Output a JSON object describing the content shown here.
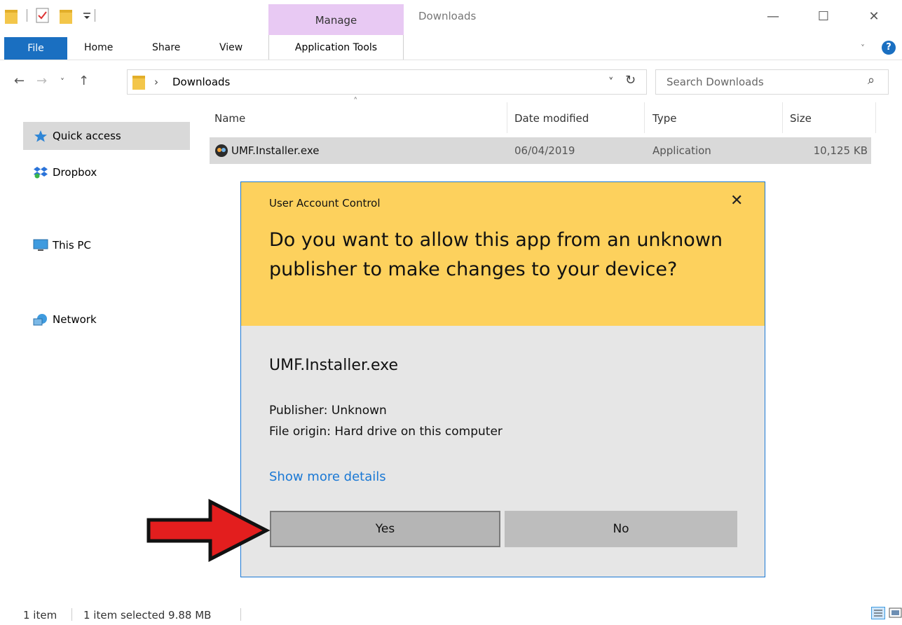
{
  "titlebar": {
    "manage_label": "Manage",
    "window_title": "Downloads",
    "quick_access_icons": [
      "folder-icon",
      "properties-checkmark-icon",
      "new-folder-icon",
      "customize-dropdown-icon"
    ],
    "controls": {
      "minimize": "—",
      "maximize": "☐",
      "close": "✕"
    }
  },
  "ribbon": {
    "tabs": [
      {
        "label": "File"
      },
      {
        "label": "Home"
      },
      {
        "label": "Share"
      },
      {
        "label": "View"
      },
      {
        "label": "Application Tools"
      }
    ],
    "help_icon": "?"
  },
  "navbar": {
    "back": "←",
    "forward": "→",
    "recent": "˅",
    "up": "↑",
    "crumb_sep": "›",
    "location": "Downloads",
    "dropdown": "˅",
    "refresh": "↻",
    "search_placeholder": "Search Downloads",
    "search_icon": "⌕"
  },
  "sidebar": {
    "items": [
      {
        "label": "Quick access",
        "icon": "star-icon",
        "active": true
      },
      {
        "label": "Dropbox",
        "icon": "dropbox-icon",
        "active": false
      },
      {
        "label": "This PC",
        "icon": "monitor-icon",
        "active": false
      },
      {
        "label": "Network",
        "icon": "network-icon",
        "active": false
      }
    ]
  },
  "filelist": {
    "sort_indicator": "˄",
    "columns": [
      "Name",
      "Date modified",
      "Type",
      "Size"
    ],
    "rows": [
      {
        "name": "UMF.Installer.exe",
        "date": "06/04/2019",
        "type": "Application",
        "size": "10,125 KB",
        "selected": true
      }
    ]
  },
  "dialog": {
    "caption": "User Account Control",
    "close": "✕",
    "question": "Do you want to allow this app from an unknown publisher to make changes to your device?",
    "app_name": "UMF.Installer.exe",
    "publisher": "Publisher: Unknown",
    "origin": "File origin: Hard drive on this computer",
    "details_link": "Show more details",
    "yes_label": "Yes",
    "no_label": "No",
    "header_color": "#fdd15d",
    "accent_color": "#1a78d4"
  },
  "annotation": {
    "arrow_color": "#e31e1e"
  },
  "statusbar": {
    "item_count": "1 item",
    "selection": "1 item selected  9.88 MB"
  }
}
